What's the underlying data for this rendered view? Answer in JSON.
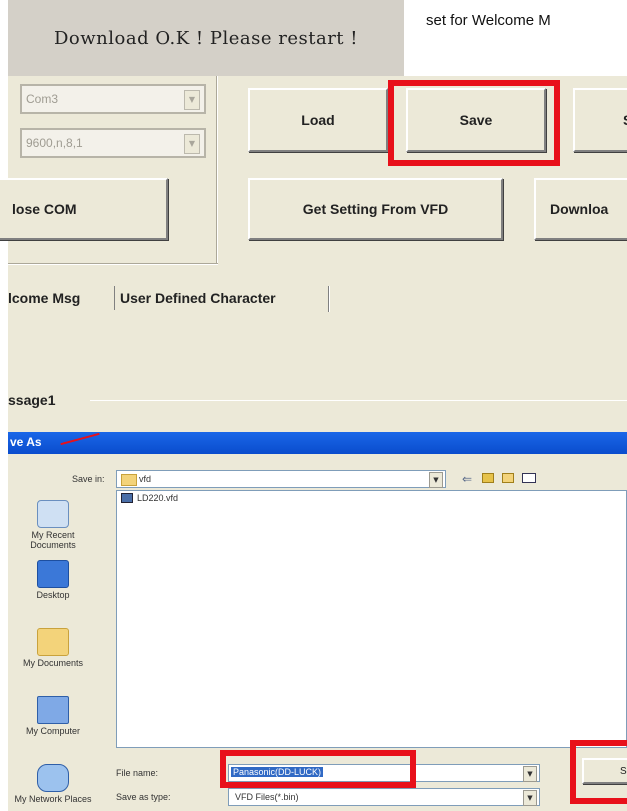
{
  "banner": {
    "text": "Download O.K ! Please restart !"
  },
  "side_note": "set for Welcome M",
  "app": {
    "com_port": "Com3",
    "baud_setting": "9600,n,8,1",
    "buttons": {
      "load": "Load",
      "save": "Save",
      "third_partial": "S",
      "close_com": "lose COM",
      "get_setting": "Get Setting From VFD",
      "download_partial": "Downloa"
    },
    "tabs": {
      "welcome": "lcome Msg",
      "user_defined": "User Defined Character"
    },
    "message_group": "ssage1"
  },
  "save_dialog": {
    "title": "ve As",
    "save_in_label": "Save in:",
    "save_in_value": "vfd",
    "files": [
      "LD220.vfd"
    ],
    "places": [
      "My Recent Documents",
      "Desktop",
      "My Documents",
      "My Computer",
      "My Network Places"
    ],
    "file_name_label": "File name:",
    "file_name_value": "Panasonic(DD-LUCK)",
    "save_type_label": "Save as type:",
    "save_type_value": "VFD Files(*.bin)",
    "save_button_partial": "S"
  },
  "colors": {
    "highlight": "#e8101a",
    "title_blue": "#0a4ccd"
  }
}
